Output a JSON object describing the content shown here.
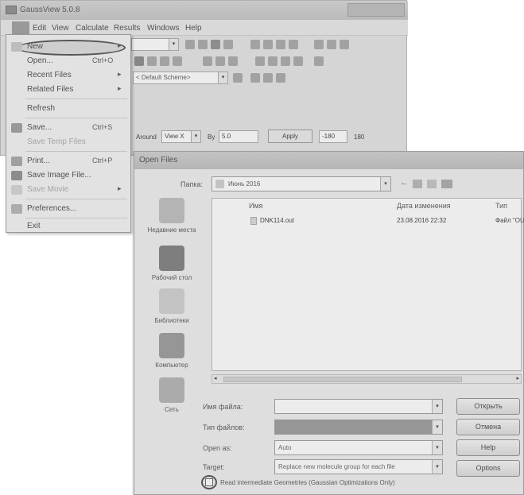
{
  "main_window": {
    "title": "GaussView 5.0.8",
    "menu": [
      "Edit",
      "View",
      "Calculate",
      "Results",
      "Windows",
      "Help"
    ],
    "scheme_combo": "< Default Scheme>",
    "rotate_label": "Around",
    "rotate_axis": "View X",
    "rotate_by_label": "By",
    "rotate_by_value": "5.0",
    "apply_label": "Apply",
    "rotate_range_value": "-180",
    "rotate_max": "180"
  },
  "file_menu": {
    "items": [
      {
        "label": "New",
        "shortcut": "",
        "submenu": "▸",
        "enabled": true
      },
      {
        "label": "Open...",
        "shortcut": "Ctrl+O",
        "submenu": "",
        "enabled": true
      },
      {
        "label": "Recent Files",
        "shortcut": "",
        "submenu": "▸",
        "enabled": true
      },
      {
        "label": "Related Files",
        "shortcut": "",
        "submenu": "▸",
        "enabled": true
      },
      {
        "label": "Refresh",
        "shortcut": "",
        "submenu": "",
        "enabled": true
      },
      {
        "label": "Save...",
        "shortcut": "Ctrl+S",
        "submenu": "",
        "enabled": true
      },
      {
        "label": "Save Temp Files",
        "shortcut": "",
        "submenu": "",
        "enabled": false
      },
      {
        "label": "Print...",
        "shortcut": "Ctrl+P",
        "submenu": "",
        "enabled": true
      },
      {
        "label": "Save Image File...",
        "shortcut": "",
        "submenu": "",
        "enabled": true
      },
      {
        "label": "Save Movie",
        "shortcut": "",
        "submenu": "▸",
        "enabled": false
      },
      {
        "label": "Preferences...",
        "shortcut": "",
        "submenu": "",
        "enabled": true
      },
      {
        "label": "Exit",
        "shortcut": "",
        "submenu": "",
        "enabled": true
      }
    ]
  },
  "dialog": {
    "title": "Open Files",
    "folder_label": "Папка:",
    "folder_value": "Июнь 2016",
    "places": [
      "Недавние места",
      "Рабочий стол",
      "Библиотеки",
      "Компьютер",
      "Сеть"
    ],
    "columns": [
      "Имя",
      "Дата изменения",
      "Тип"
    ],
    "files": [
      {
        "name": "DNK114.out",
        "date": "23.08.2016 22:32",
        "type": "Файл \"OUT\""
      }
    ],
    "filename_label": "Имя файла:",
    "filename_value": "",
    "filetype_label": "Тип файлов:",
    "filetype_value": "",
    "open_as_label": "Open as:",
    "open_as_value": "Auto",
    "target_label": "Target:",
    "target_value": "Replace new molecule group for each file",
    "open_button": "Открыть",
    "cancel_button": "Отмена",
    "help_button": "Help",
    "options_button": "Options",
    "checkbox_label": "Read intermediate Geometries (Gaussian Optimizations Only)"
  }
}
